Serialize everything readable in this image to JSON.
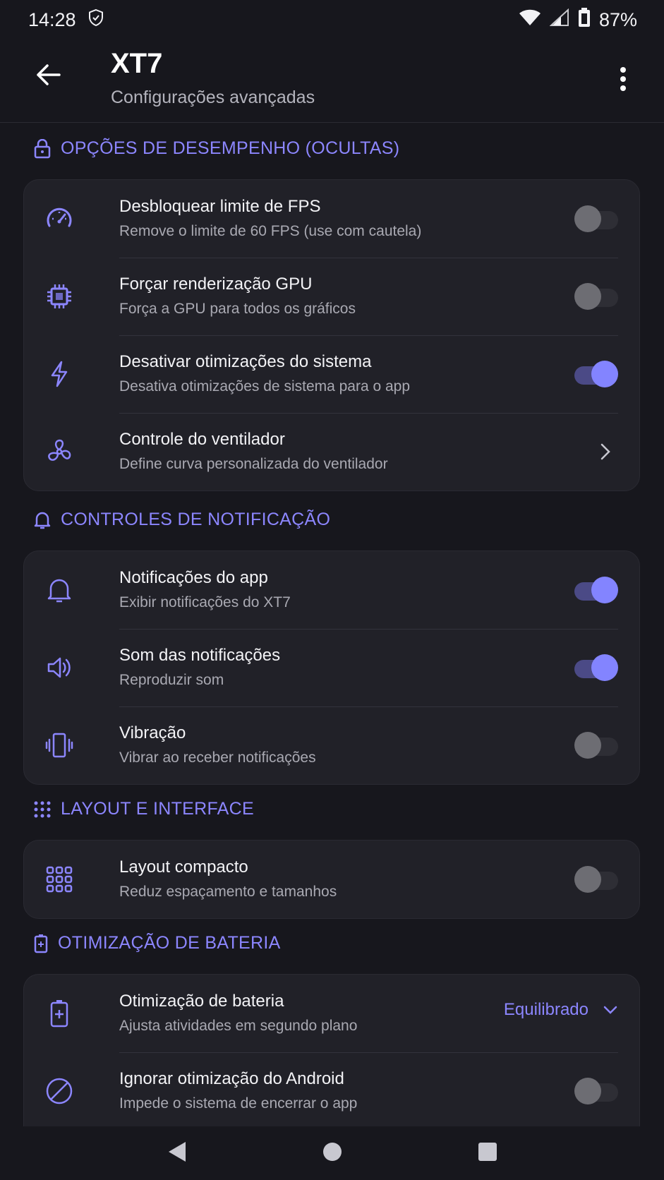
{
  "status_bar": {
    "time": "14:28",
    "battery": "87%"
  },
  "app_bar": {
    "title": "XT7",
    "subtitle": "Configurações avançadas"
  },
  "sections": {
    "performance": {
      "header": "OPÇÕES DE DESEMPENHO (OCULTAS)",
      "items": [
        {
          "title": "Desbloquear limite de FPS",
          "subtitle": "Remove o limite de 60 FPS (use com cautela)",
          "control": "toggle",
          "on": false,
          "icon": "speedometer-icon"
        },
        {
          "title": "Forçar renderização GPU",
          "subtitle": "Força a GPU para todos os gráficos",
          "control": "toggle",
          "on": false,
          "icon": "chip-icon"
        },
        {
          "title": "Desativar otimizações do sistema",
          "subtitle": "Desativa otimizações de sistema para o app",
          "control": "toggle",
          "on": true,
          "icon": "lightning-icon"
        },
        {
          "title": "Controle do ventilador",
          "subtitle": "Define curva personalizada do ventilador",
          "control": "chevron",
          "icon": "fan-icon"
        }
      ]
    },
    "notifications": {
      "header": "CONTROLES DE NOTIFICAÇÃO",
      "items": [
        {
          "title": "Notificações do app",
          "subtitle": "Exibir notificações do XT7",
          "control": "toggle",
          "on": true,
          "icon": "bell-icon"
        },
        {
          "title": "Som das notificações",
          "subtitle": "Reproduzir som",
          "control": "toggle",
          "on": true,
          "icon": "speaker-icon"
        },
        {
          "title": "Vibração",
          "subtitle": "Vibrar ao receber notificações",
          "control": "toggle",
          "on": false,
          "icon": "vibrate-icon"
        }
      ]
    },
    "layout": {
      "header": "LAYOUT E INTERFACE",
      "items": [
        {
          "title": "Layout compacto",
          "subtitle": "Reduz espaçamento e tamanhos",
          "control": "toggle",
          "on": false,
          "icon": "grid-icon"
        }
      ]
    },
    "battery": {
      "header": "OTIMIZAÇÃO DE BATERIA",
      "items": [
        {
          "title": "Otimização de bateria",
          "subtitle": "Ajusta atividades em segundo plano",
          "control": "dropdown",
          "value": "Equilibrado",
          "icon": "battery-icon"
        },
        {
          "title": "Ignorar otimização do Android",
          "subtitle": "Impede o sistema de encerrar o app",
          "control": "toggle",
          "on": false,
          "icon": "block-icon"
        }
      ]
    }
  },
  "colors": {
    "accent": "#8c86ff",
    "toggle_on": "#8384ff",
    "background": "#17171d",
    "card": "#212128"
  }
}
